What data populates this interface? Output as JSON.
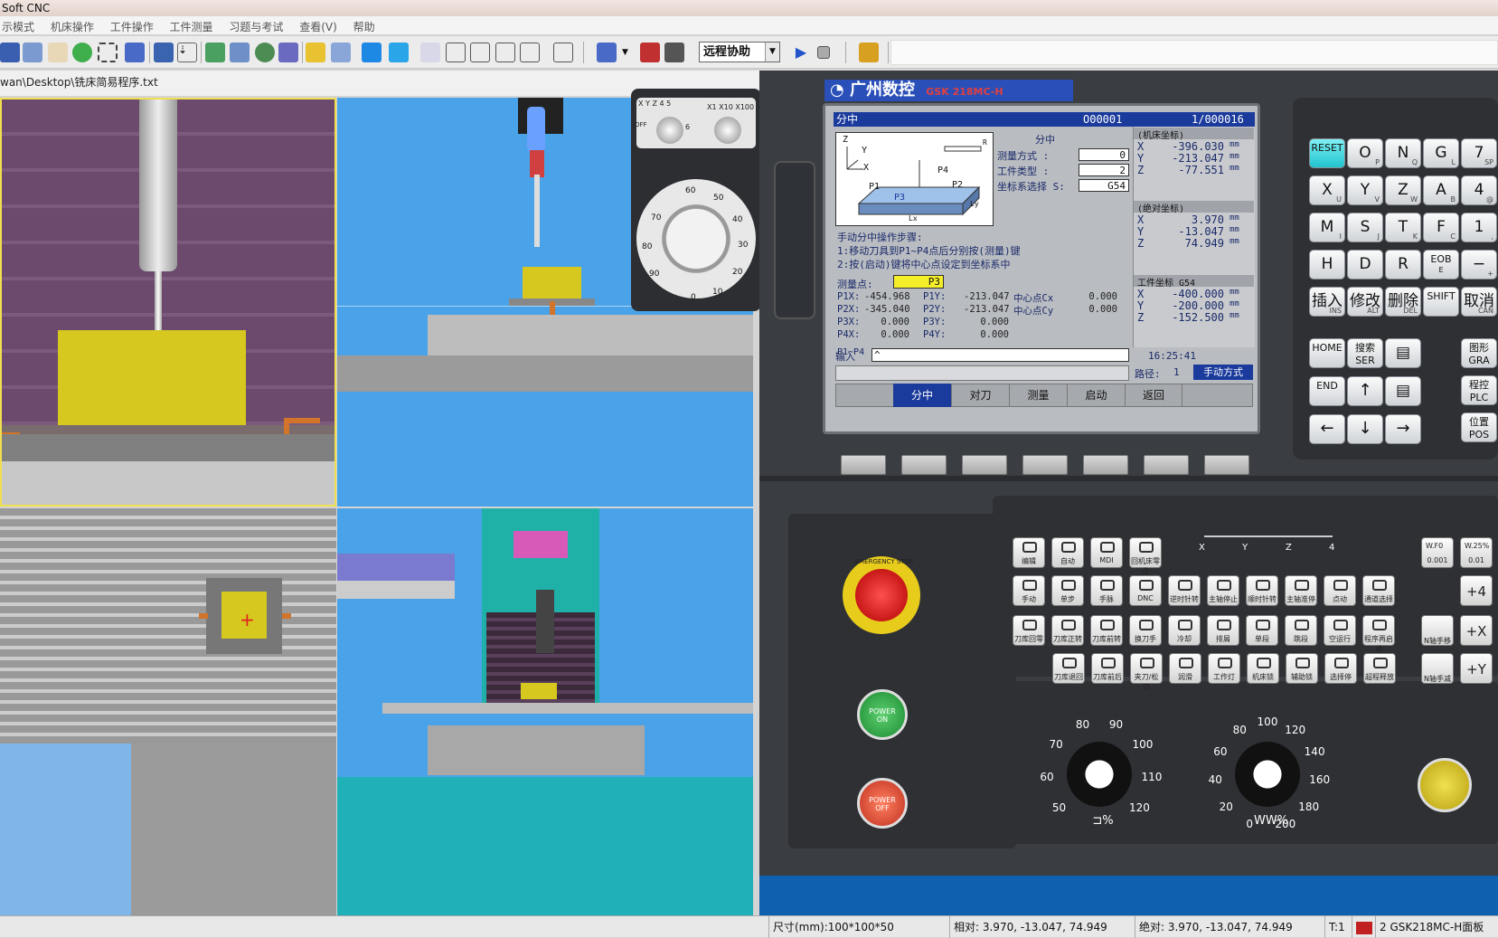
{
  "window": {
    "title": "Soft CNC"
  },
  "menu": {
    "items": [
      "示模式",
      "机床操作",
      "工件操作",
      "工件测量",
      "习题与考试",
      "查看(V)",
      "帮助"
    ]
  },
  "toolbar": {
    "mode_value": "远程协助"
  },
  "path": {
    "text": "wan\\Desktop\\铣床简易程序.txt"
  },
  "handwheel": {
    "axis_labels": [
      "X",
      "Y",
      "Z",
      "4",
      "5",
      "OFF",
      "6"
    ],
    "scale_labels": [
      "X1",
      "X10",
      "X100"
    ],
    "dial_numbers": [
      "60",
      "50",
      "40",
      "30",
      "20",
      "10",
      "0",
      "90",
      "80",
      "70"
    ]
  },
  "brand": {
    "logo": "广州数控",
    "model": "GSK 218MC-H"
  },
  "lcd": {
    "mode": "分中",
    "program": "O00001",
    "block": "1/000016",
    "diagram_labels": [
      "Z",
      "Y",
      "X",
      "P4",
      "P1",
      "P3",
      "P2",
      "Ly",
      "Lx",
      "R"
    ],
    "fields": [
      {
        "label": "测量方式 :",
        "value": "0"
      },
      {
        "label": "工件类型 :",
        "value": "2"
      },
      {
        "label": "坐标系选择 S:",
        "value": "G54"
      }
    ],
    "instructions_title": "手动分中操作步骤:",
    "instructions": [
      "1:移动刀具到P1~P4点后分别按(测量)键",
      "2:按(启动)键将中心点设定到坐标系中"
    ],
    "measure_point_label": "测量点:",
    "measure_point_value": "P3",
    "points": [
      [
        "P1X:",
        "-454.968",
        "P1Y:",
        "-213.047",
        "中心点Cx",
        "0.000"
      ],
      [
        "P2X:",
        "-345.040",
        "P2Y:",
        "-213.047",
        "中心点Cy",
        "0.000"
      ],
      [
        "P3X:",
        "0.000",
        "P3Y:",
        "0.000",
        "",
        ""
      ],
      [
        "P4X:",
        "0.000",
        "P4Y:",
        "0.000",
        "",
        ""
      ]
    ],
    "range": "P1~P4",
    "machine_coord": {
      "title": "(机床坐标)",
      "rows": [
        [
          "X",
          "-396.030",
          "mm"
        ],
        [
          "Y",
          "-213.047",
          "mm"
        ],
        [
          "Z",
          "-77.551",
          "mm"
        ]
      ]
    },
    "abs_coord": {
      "title": "(绝对坐标)",
      "rows": [
        [
          "X",
          "3.970",
          "mm"
        ],
        [
          "Y",
          "-13.047",
          "mm"
        ],
        [
          "Z",
          "74.949",
          "mm"
        ]
      ]
    },
    "work_coord": {
      "title": "工件坐标 G54",
      "rows": [
        [
          "X",
          "-400.000",
          "mm"
        ],
        [
          "Y",
          "-200.000",
          "mm"
        ],
        [
          "Z",
          "-152.500",
          "mm"
        ]
      ]
    },
    "input_label": "输入",
    "input_value": "^",
    "time": "16:25:41",
    "path_label": "路径:",
    "path_value": "1",
    "mode_status": "手动方式",
    "softkeys": [
      "分中",
      "对刀",
      "测量",
      "启动",
      "返回"
    ]
  },
  "keypad": {
    "rows": [
      [
        {
          "m": "RESET",
          "s": ""
        },
        {
          "m": "O",
          "s": "P"
        },
        {
          "m": "N",
          "s": "Q"
        },
        {
          "m": "G",
          "s": "L"
        },
        {
          "m": "7",
          "s": "SP"
        }
      ],
      [
        {
          "m": "X",
          "s": "U"
        },
        {
          "m": "Y",
          "s": "V"
        },
        {
          "m": "Z",
          "s": "W"
        },
        {
          "m": "A",
          "s": "B"
        },
        {
          "m": "4",
          "s": "@"
        }
      ],
      [
        {
          "m": "M",
          "s": "I"
        },
        {
          "m": "S",
          "s": "J"
        },
        {
          "m": "T",
          "s": "K"
        },
        {
          "m": "F",
          "s": "C"
        },
        {
          "m": "1",
          "s": ","
        }
      ],
      [
        {
          "m": "H",
          "s": ""
        },
        {
          "m": "D",
          "s": ""
        },
        {
          "m": "R",
          "s": ""
        },
        {
          "m": "EOB",
          "s": "E"
        },
        {
          "m": "−",
          "s": "+"
        }
      ],
      [
        {
          "m": "插入",
          "s": "INS"
        },
        {
          "m": "修改",
          "s": "ALT"
        },
        {
          "m": "删除",
          "s": "DEL"
        },
        {
          "m": "SHIFT",
          "s": ""
        },
        {
          "m": "取消",
          "s": "CAN"
        }
      ]
    ],
    "nav": [
      "HOME",
      "搜索\nSER",
      "END",
      "↑",
      "←",
      "↓",
      "→"
    ],
    "side": [
      "图形\nGRA",
      "程控\nPLC",
      "位置\nPOS"
    ]
  },
  "operator": {
    "estop": "EMERGENCY STOP",
    "power_on": "POWER\nON",
    "power_off": "POWER\nOFF",
    "axis_indicators": [
      "X",
      "Y",
      "Z",
      "4"
    ],
    "row1": [
      "编辑",
      "自动",
      "MDI",
      "回机床零点"
    ],
    "row2": [
      "手动",
      "单步",
      "手脉",
      "DNC",
      "逆时针转",
      "主轴停止",
      "顺时针转",
      "主轴准停",
      "点动",
      "通道选择"
    ],
    "row3": [
      "刀库回零",
      "刀库正转",
      "刀库前转",
      "换刀手",
      "冷却",
      "排屑",
      "单段",
      "跳段",
      "空运行",
      "程序再启动"
    ],
    "row4": [
      "刀库退回",
      "刀库前后",
      "夹刀/松刀",
      "润滑",
      "工作灯",
      "机床锁",
      "辅助锁",
      "选择停",
      "超程释放"
    ],
    "feed_override": [
      "0.001",
      "0.01"
    ],
    "feed_labels": [
      "W.F0",
      "W.25%"
    ],
    "axis_jog": [
      "+4",
      "+X",
      "+Y"
    ],
    "axis_jog_left": [
      "N轴手移",
      "N轴手减"
    ],
    "spindle_dial": [
      "50",
      "60",
      "70",
      "80",
      "90",
      "100",
      "110",
      "120"
    ],
    "spindle_label": "⊐%",
    "feed_dial": [
      "0",
      "20",
      "40",
      "60",
      "80",
      "100",
      "120",
      "140",
      "160",
      "180",
      "200"
    ],
    "feed_label": "WW%"
  },
  "statusbar": {
    "size": "尺寸(mm):100*100*50",
    "relative": "相对:   3.970,  -13.047,   74.949",
    "absolute": "绝对:   3.970,  -13.047,   74.949",
    "tool": "T:1",
    "machine": "2 GSK218MC-H面板"
  },
  "colors": {
    "lcd_bg": "#b9bcc0",
    "lcd_blue": "#1a3a9c",
    "panel": "#3a3d42",
    "view_sky": "#4aa3e8",
    "view_purple": "#6b4a6e",
    "workpiece": "#d6c81e"
  }
}
